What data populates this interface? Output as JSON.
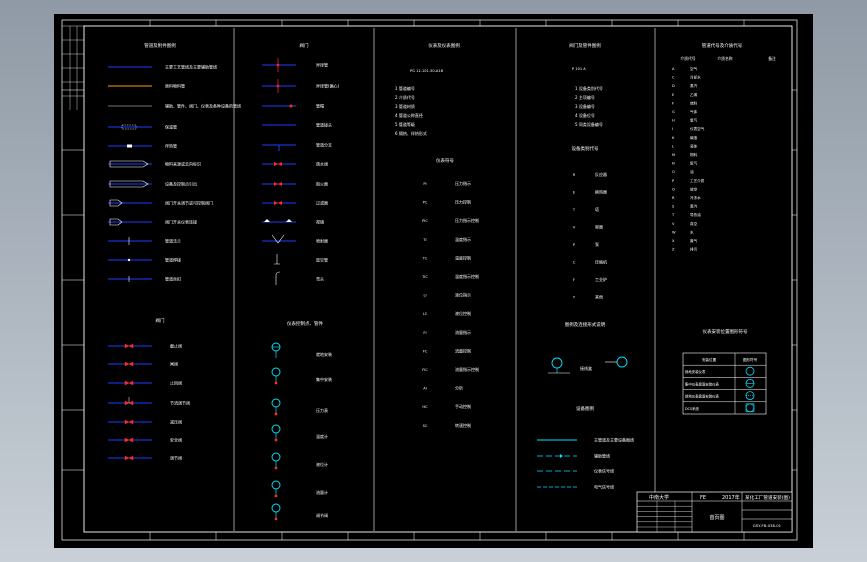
{
  "titleblock": {
    "school": "中南大学",
    "code": "FE",
    "year": "2017年",
    "project": "某化工厂管道安装(图)",
    "sheet_name": "首页图",
    "drawing_no": "GSY-FB-038-01"
  },
  "columns": [
    {
      "heading": "管道及附件图例"
    },
    {
      "heading": "阀门"
    },
    {
      "heading": "仪表及仪表图例"
    },
    {
      "heading": "阀门及管件图例"
    },
    {
      "heading": "管道代号及介质代号"
    }
  ],
  "col1_labels": [
    "主要工艺管线及主要辅助管线",
    "原料物料管",
    "辅助、管件、阀门、仪表及各种设备的管线",
    "保温管",
    "伴热管",
    "物料来源或去向标识",
    "设备及控制点引出",
    "阀门开关调节或可控制阀门",
    "阀门开关仪表连接",
    "管道法兰",
    "管道焊接",
    "管道丝扣"
  ],
  "col1_sub": "阀门",
  "col1b_labels": [
    "截止阀",
    "闸阀",
    "止回阀",
    "节流调节阀",
    "减压阀",
    "安全阀",
    "调节阀"
  ],
  "col2_labels": [
    "异径管",
    "异径管(偏心)",
    "管帽",
    "管道接头",
    "管道分支",
    "疏水阀",
    "阻火器",
    "过滤器",
    "视镜",
    "喷射器",
    "放空管",
    "弯头"
  ],
  "col2_sub": "仪表控制点、管件",
  "col2b_labels": [
    "就地安装",
    "集中安装",
    "压力表",
    "温度计",
    "液位计",
    "流量计",
    "调节阀"
  ],
  "col3_codes": [
    "1 管道编号",
    "2 介质代号",
    "3 管道材质",
    "4 管道公称直径",
    "5 管道等级",
    "6 隔热、伴热形式"
  ],
  "col3_sub": "仪表符号",
  "col3_rows": [
    {
      "code": "PI",
      "label": "压力指示"
    },
    {
      "code": "PC",
      "label": "压力控制"
    },
    {
      "code": "PIC",
      "label": "压力指示控制"
    },
    {
      "code": "TI",
      "label": "温度指示"
    },
    {
      "code": "TC",
      "label": "温度控制"
    },
    {
      "code": "TIC",
      "label": "温度指示控制"
    },
    {
      "code": "LI",
      "label": "液位指示"
    },
    {
      "code": "LC",
      "label": "液位控制"
    },
    {
      "code": "FI",
      "label": "流量指示"
    },
    {
      "code": "FC",
      "label": "流量控制"
    },
    {
      "code": "FIC",
      "label": "流量指示控制"
    },
    {
      "code": "AI",
      "label": "分析"
    },
    {
      "code": "HC",
      "label": "手动控制"
    },
    {
      "code": "SC",
      "label": "转速控制"
    }
  ],
  "col4_codes": [
    "1 设备类别代号",
    "2 主项编号",
    "3 设备编号",
    "4 设备位号",
    "5 同类设备编号"
  ],
  "col4_sub": "设备类别代号",
  "col4_rows": [
    {
      "code": "R",
      "label": "反应器"
    },
    {
      "code": "E",
      "label": "换热器"
    },
    {
      "code": "T",
      "label": "塔"
    },
    {
      "code": "V",
      "label": "容器"
    },
    {
      "code": "P",
      "label": "泵"
    },
    {
      "code": "C",
      "label": "压缩机"
    },
    {
      "code": "F",
      "label": "工业炉"
    },
    {
      "code": "Y",
      "label": "其他"
    }
  ],
  "col4_sub2": "图例及连接形式说明",
  "col4_sub3": "设备图例",
  "col4_lines": [
    "主管道及主要设备图线",
    "辅助管线",
    "仪表信号线",
    "电气信号线"
  ],
  "col5_head": [
    "介质代号",
    "介质名称",
    "备注"
  ],
  "col5_rows": [
    {
      "code": "A",
      "label": "空气"
    },
    {
      "code": "C",
      "label": "冷却水"
    },
    {
      "code": "D",
      "label": "蒸汽"
    },
    {
      "code": "E",
      "label": "乙烯"
    },
    {
      "code": "F",
      "label": "燃料"
    },
    {
      "code": "G",
      "label": "气体"
    },
    {
      "code": "H",
      "label": "氢气"
    },
    {
      "code": "I",
      "label": "仪表空气"
    },
    {
      "code": "K",
      "label": "碱液"
    },
    {
      "code": "L",
      "label": "液体"
    },
    {
      "code": "M",
      "label": "物料"
    },
    {
      "code": "N",
      "label": "氮气"
    },
    {
      "code": "O",
      "label": "油"
    },
    {
      "code": "P",
      "label": "工艺介质"
    },
    {
      "code": "Q",
      "label": "放空"
    },
    {
      "code": "R",
      "label": "冷冻水"
    },
    {
      "code": "S",
      "label": "蒸汽"
    },
    {
      "code": "T",
      "label": "导热油"
    },
    {
      "code": "V",
      "label": "真空"
    },
    {
      "code": "W",
      "label": "水"
    },
    {
      "code": "X",
      "label": "废气"
    },
    {
      "code": "Z",
      "label": "排污"
    }
  ],
  "col5_sub": "仪表安装位置图形符号",
  "col5_table_head": [
    "安装位置",
    "图形符号"
  ],
  "col5_table": [
    "就地安装仪表",
    "集中仪表盘面安装仪表",
    "就地仪表盘面安装仪表",
    "DCS系统"
  ],
  "colors": {
    "bg": "#000000",
    "frame": "#ffffff",
    "line_blue": "#1f3bff",
    "line_cyan": "#00e5ff",
    "red": "#ff2a2a",
    "orange": "#ff9a1f"
  }
}
